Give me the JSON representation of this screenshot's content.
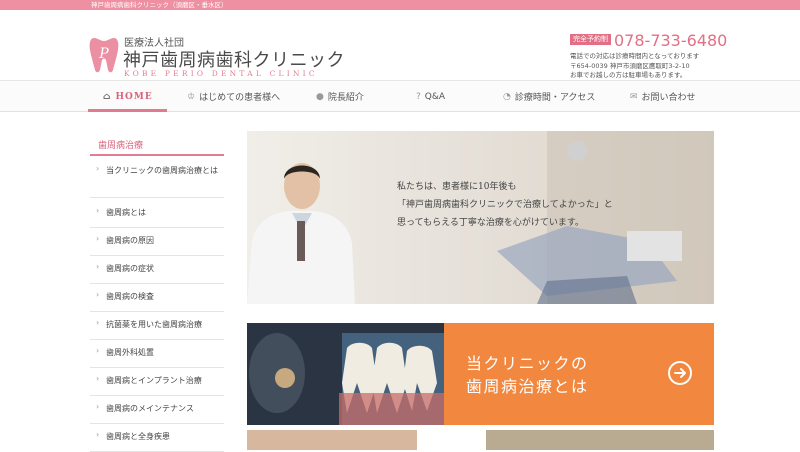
{
  "topbar": {
    "text": "神戸歯周病歯科クリニック（須磨区・垂水区）"
  },
  "logo": {
    "sub": "医療法人社団",
    "name": "神戸歯周病歯科クリニック",
    "en": "KOBE PERIO DENTAL CLINIC",
    "mark_letter": "P"
  },
  "contact": {
    "badge": "完全予約制",
    "phone": "078-733-6480",
    "note1": "電話での対応は診療時間内となっております",
    "address": "〒654-0039 神戸市須磨区鷹取町3-2-10",
    "note2": "お車でお越しの方は駐車場もあります。"
  },
  "nav": [
    {
      "label": "HOME",
      "icon": "home-icon",
      "glyph": "⌂",
      "active": true
    },
    {
      "label": "はじめての患者様へ",
      "icon": "tooth-icon",
      "glyph": "♔",
      "active": false
    },
    {
      "label": "院長紹介",
      "icon": "person-icon",
      "glyph": "●",
      "active": false
    },
    {
      "label": "Q&A",
      "icon": "question-icon",
      "glyph": "?",
      "active": false
    },
    {
      "label": "診療時間・アクセス",
      "icon": "clock-icon",
      "glyph": "◔",
      "active": false
    },
    {
      "label": "お問い合わせ",
      "icon": "mail-icon",
      "glyph": "✉",
      "active": false
    }
  ],
  "sidebar": {
    "title": "歯周病治療",
    "items": [
      "当クリニックの歯周病治療とは",
      "歯周病とは",
      "歯周病の原因",
      "歯周病の症状",
      "歯周病の検査",
      "抗菌薬を用いた歯周病治療",
      "歯周外科処置",
      "歯周病とインプラント治療",
      "歯周病のメインテナンス",
      "歯周病と全身疾患"
    ]
  },
  "hero": {
    "lines": [
      "私たちは、患者様に10年後も",
      "「神戸歯周病歯科クリニックで治療してよかった」と",
      "思ってもらえる丁寧な治療を心がけています。"
    ]
  },
  "banner": {
    "title_line1": "当クリニックの",
    "title_line2": "歯周病治療とは"
  },
  "colors": {
    "accent": "#e27d92",
    "topbar": "#ef8fa2",
    "banner": "#f2873f",
    "phone": "#e36f86"
  }
}
